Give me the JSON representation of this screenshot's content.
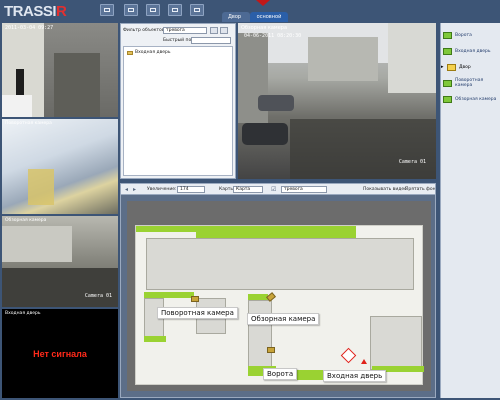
{
  "app": {
    "logo_main": "TRASSI",
    "logo_r": "R"
  },
  "tabs": [
    {
      "label": "Двор"
    },
    {
      "label": "основной"
    }
  ],
  "cameras": {
    "cam1": {
      "timestamp": "2011-03-04 09:27"
    },
    "cam2": {
      "label": "Поворотная камера"
    },
    "cam3": {
      "label": "Обзорная камера",
      "name": "Camera 01"
    },
    "cam4": {
      "label": "Входная дверь",
      "status": "Нет сигнала"
    },
    "main": {
      "label": "Обзорная камера",
      "timestamp": "04-06-2011 08:20:30",
      "name": "Camera 01"
    }
  },
  "object_panel": {
    "filter_label": "Фильтр объектов:",
    "filter_value": "тревога",
    "search_label": "Быстрый поиск:",
    "tree": [
      {
        "label": "Входная дверь"
      }
    ]
  },
  "map_toolbar": {
    "zoom_label": "Увеличение:",
    "zoom_value": "174",
    "maps_label": "Карты:",
    "maps_value": "Карта",
    "alarm_value": "тревога",
    "show_video_label": "Показывать видео",
    "hide_bg_label": "Прятать фон"
  },
  "map_labels": {
    "ptz": "Поворотная камера",
    "overview": "Обзорная камера",
    "gate": "Ворота",
    "door": "Входная дверь"
  },
  "sidebar": {
    "items": [
      {
        "label": "Ворота"
      },
      {
        "label": "Входная дверь"
      },
      {
        "label": "Двор"
      },
      {
        "label": "Поворотная камера"
      },
      {
        "label": "Обзорная камера"
      }
    ]
  },
  "colors": {
    "accent_green": "#9ad232",
    "alarm_red": "#e0221a",
    "window_bg": "#3d5576"
  }
}
